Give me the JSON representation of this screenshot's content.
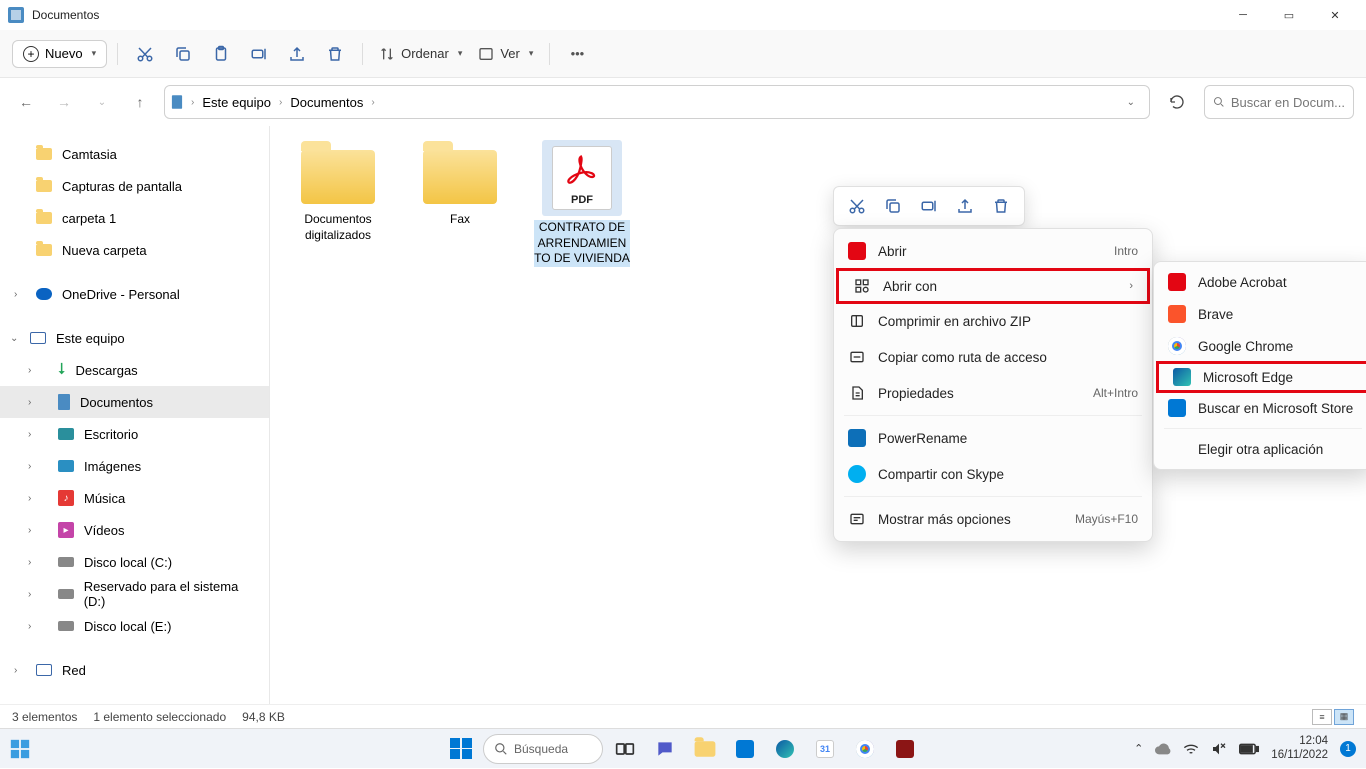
{
  "window": {
    "title": "Documentos"
  },
  "toolbar": {
    "new_label": "Nuevo",
    "sort_label": "Ordenar",
    "view_label": "Ver"
  },
  "breadcrumb": {
    "root": "Este equipo",
    "current": "Documentos"
  },
  "search": {
    "placeholder": "Buscar en Docum..."
  },
  "sidebar": {
    "quick": {
      "items": [
        {
          "label": "Camtasia"
        },
        {
          "label": "Capturas de pantalla"
        },
        {
          "label": "carpeta 1"
        },
        {
          "label": "Nueva carpeta"
        }
      ]
    },
    "onedrive": {
      "label": "OneDrive - Personal"
    },
    "thispc": {
      "label": "Este equipo",
      "items": [
        {
          "label": "Descargas"
        },
        {
          "label": "Documentos"
        },
        {
          "label": "Escritorio"
        },
        {
          "label": "Imágenes"
        },
        {
          "label": "Música"
        },
        {
          "label": "Vídeos"
        },
        {
          "label": "Disco local (C:)"
        },
        {
          "label": "Reservado para el sistema (D:)"
        },
        {
          "label": "Disco local (E:)"
        }
      ]
    },
    "network": {
      "label": "Red"
    }
  },
  "files": {
    "items": [
      {
        "name": "Documentos digitalizados"
      },
      {
        "name": "Fax"
      },
      {
        "name": "CONTRATO DE ARRENDAMIENTO DE VIVIENDA"
      }
    ]
  },
  "pdf_badge": "PDF",
  "context_menu": {
    "open": {
      "label": "Abrir",
      "shortcut": "Intro"
    },
    "open_with": {
      "label": "Abrir con"
    },
    "compress": {
      "label": "Comprimir en archivo ZIP"
    },
    "copy_path": {
      "label": "Copiar como ruta de acceso"
    },
    "properties": {
      "label": "Propiedades",
      "shortcut": "Alt+Intro"
    },
    "power_rename": {
      "label": "PowerRename"
    },
    "share_skype": {
      "label": "Compartir con Skype"
    },
    "show_more": {
      "label": "Mostrar más opciones",
      "shortcut": "Mayús+F10"
    }
  },
  "open_with_submenu": {
    "items": [
      {
        "label": "Adobe Acrobat",
        "color": "#e30613"
      },
      {
        "label": "Brave",
        "color": "#fb542b"
      },
      {
        "label": "Google Chrome",
        "color": "#ffffff"
      },
      {
        "label": "Microsoft Edge",
        "color": "#0c59a4"
      },
      {
        "label": "Buscar en Microsoft Store",
        "color": "#0078d4"
      }
    ],
    "choose_another": "Elegir otra aplicación"
  },
  "statusbar": {
    "count": "3 elementos",
    "selected": "1 elemento seleccionado",
    "size": "94,8 KB"
  },
  "taskbar": {
    "search": "Búsqueda",
    "time": "12:04",
    "date": "16/11/2022",
    "notif_count": "1"
  }
}
